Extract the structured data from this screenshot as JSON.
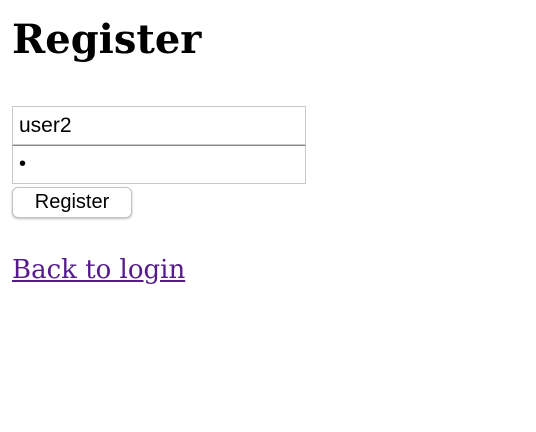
{
  "page": {
    "title": "Register"
  },
  "form": {
    "username_value": "user2",
    "password_value": "•",
    "submit_label": "Register"
  },
  "links": {
    "back_to_login": "Back to login"
  },
  "colors": {
    "link_visited": "#551a8b",
    "input_border": "#c8c8c8"
  }
}
